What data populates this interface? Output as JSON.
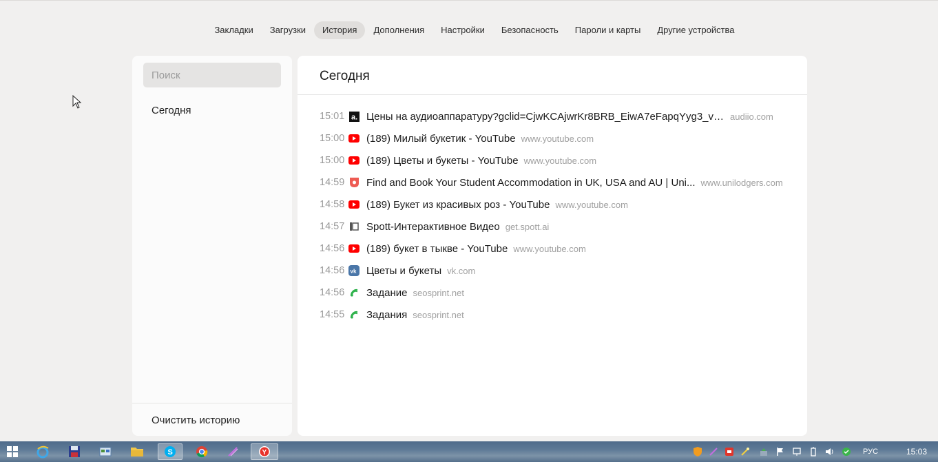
{
  "nav": {
    "items": [
      {
        "label": "Закладки",
        "active": false
      },
      {
        "label": "Загрузки",
        "active": false
      },
      {
        "label": "История",
        "active": true
      },
      {
        "label": "Дополнения",
        "active": false
      },
      {
        "label": "Настройки",
        "active": false
      },
      {
        "label": "Безопасность",
        "active": false
      },
      {
        "label": "Пароли и карты",
        "active": false
      },
      {
        "label": "Другие устройства",
        "active": false
      }
    ]
  },
  "sidebar": {
    "search_placeholder": "Поиск",
    "item_today": "Сегодня",
    "clear_history": "Очистить историю"
  },
  "main": {
    "section_title": "Сегодня",
    "entries": [
      {
        "time": "15:01",
        "icon": "audiio-icon",
        "title": "Цены на аудиоаппаратуру?gclid=CjwKCAjwrKr8BRB_EiwA7eFapqYyg3_vngg...",
        "domain": "audiio.com"
      },
      {
        "time": "15:00",
        "icon": "youtube-icon",
        "title": "(189) Милый букетик - YouTube",
        "domain": "www.youtube.com"
      },
      {
        "time": "15:00",
        "icon": "youtube-icon",
        "title": "(189) Цветы и букеты - YouTube",
        "domain": "www.youtube.com"
      },
      {
        "time": "14:59",
        "icon": "unilodgers-icon",
        "title": "Find and Book Your Student Accommodation in UK, USA and AU | Uni...",
        "domain": "www.unilodgers.com"
      },
      {
        "time": "14:58",
        "icon": "youtube-icon",
        "title": "(189) Букет из красивых роз - YouTube",
        "domain": "www.youtube.com"
      },
      {
        "time": "14:57",
        "icon": "spott-icon",
        "title": "Spott-Интерактивное Видео",
        "domain": "get.spott.ai"
      },
      {
        "time": "14:56",
        "icon": "youtube-icon",
        "title": "(189) букет в тыкве - YouTube",
        "domain": "www.youtube.com"
      },
      {
        "time": "14:56",
        "icon": "vk-icon",
        "title": "Цветы и букеты",
        "domain": "vk.com"
      },
      {
        "time": "14:56",
        "icon": "seosprint-icon",
        "title": "Задание",
        "domain": "seosprint.net"
      },
      {
        "time": "14:55",
        "icon": "seosprint-icon",
        "title": "Задания",
        "domain": "seosprint.net"
      }
    ]
  },
  "taskbar": {
    "language": "РУС",
    "clock": "15:03"
  },
  "colors": {
    "background": "#f1f0ef",
    "youtube_red": "#ff0000",
    "vk_blue": "#4a76a8",
    "seosprint_green": "#2fb24c",
    "unilodgers_red": "#ee5b53"
  }
}
